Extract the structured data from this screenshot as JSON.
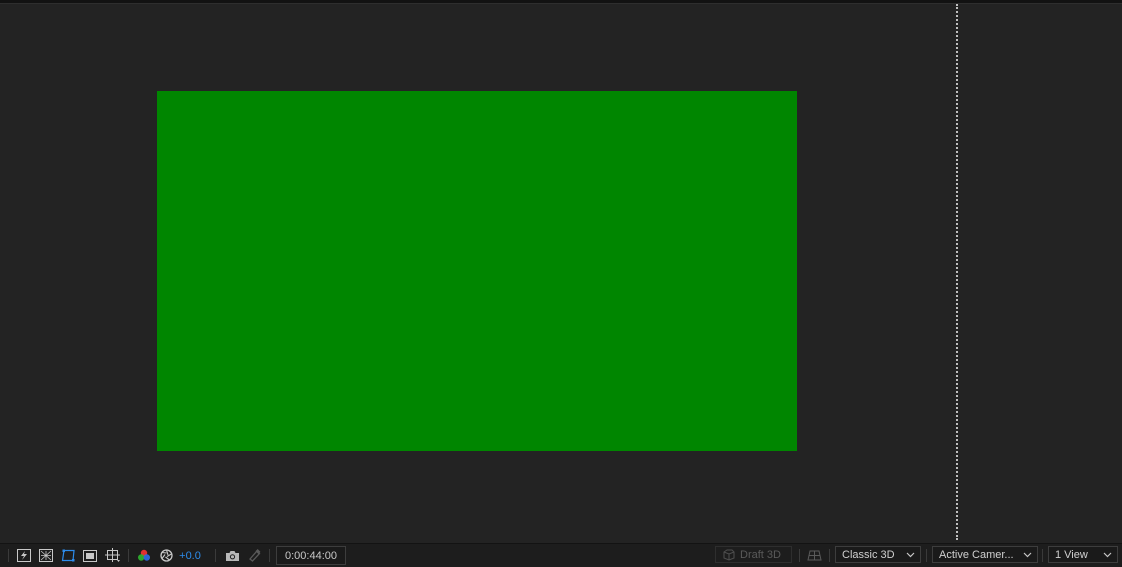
{
  "viewer": {
    "comp_color": "#008600",
    "background": "#232323"
  },
  "toolbar": {
    "icons": [
      "fast-previews-icon",
      "transparency-grid-icon",
      "mask-path-visibility-icon",
      "region-of-interest-icon",
      "toggle-guides-icon",
      "show-channel-icon",
      "reset-exposure-icon",
      "snapshot-icon",
      "show-snapshot-icon",
      "3d-ground-plane-icon"
    ],
    "exposure_value": "+0.0",
    "timecode": "0:00:44:00",
    "draft3d_label": "Draft 3D",
    "renderer": "Classic 3D",
    "camera": "Active Camer...",
    "views": "1 View"
  },
  "colors": {
    "accent": "#2d8ceb",
    "toolbar_bg": "#1d1d1d"
  }
}
